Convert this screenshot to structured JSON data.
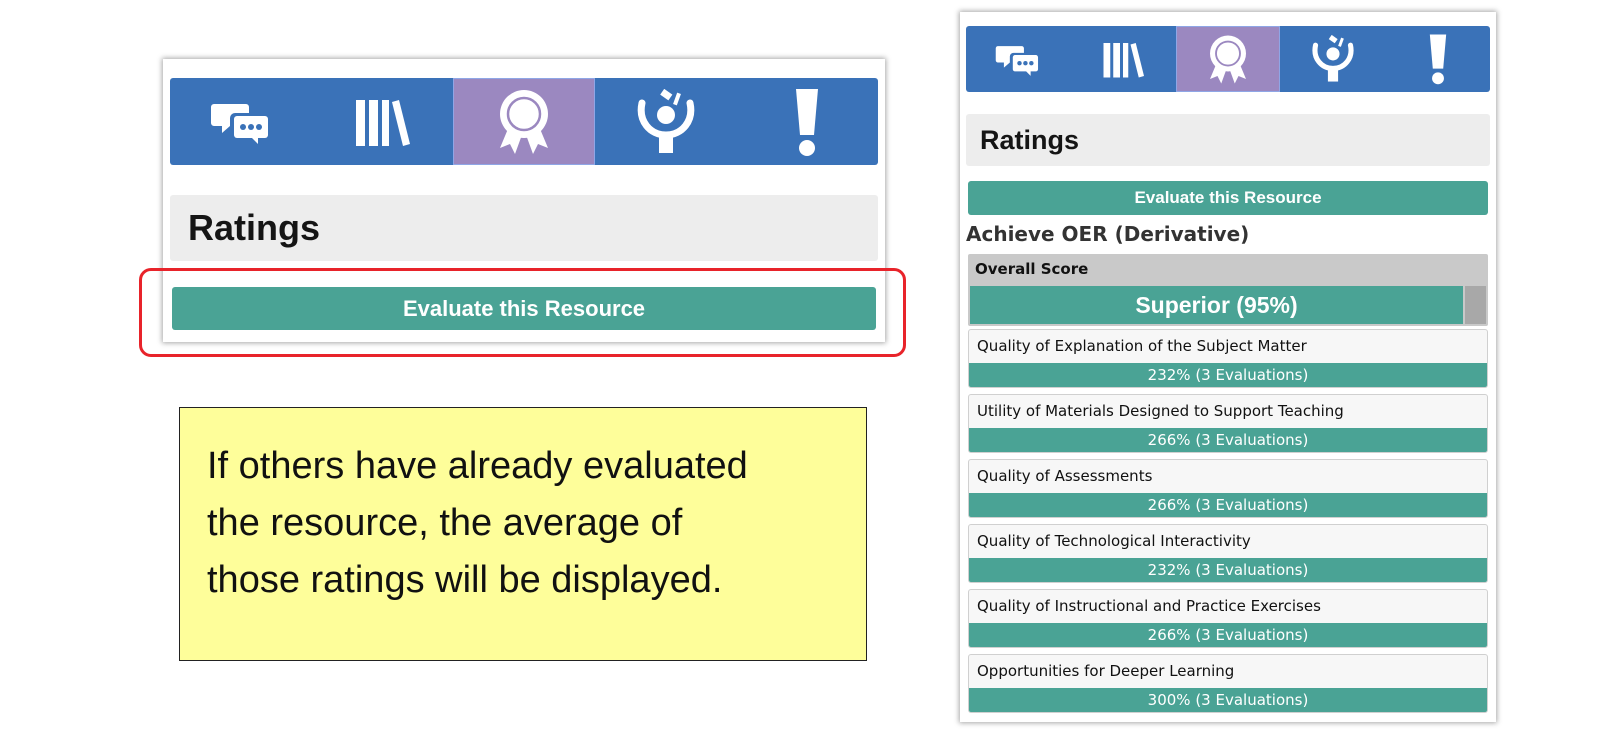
{
  "left_panel": {
    "tabs": [
      {
        "icon": "discussion-icon",
        "active": false
      },
      {
        "icon": "library-icon",
        "active": false
      },
      {
        "icon": "award-ribbon-icon",
        "active": true
      },
      {
        "icon": "person-standards-icon",
        "active": false
      },
      {
        "icon": "alert-icon",
        "active": false
      }
    ],
    "heading": "Ratings",
    "evaluate_label": "Evaluate this Resource"
  },
  "note": {
    "lines": [
      "If others have already evaluated",
      "the resource, the average of",
      "those ratings will be displayed."
    ]
  },
  "right_panel": {
    "heading": "Ratings",
    "evaluate_label": "Evaluate this Resource",
    "subtitle": "Achieve OER (Derivative)",
    "overall": {
      "label": "Overall Score",
      "value": "Superior (95%)"
    },
    "ratings": [
      {
        "label": "Quality of Explanation of the Subject Matter",
        "value": "232% (3 Evaluations)"
      },
      {
        "label": "Utility of Materials Designed to Support Teaching",
        "value": "266% (3 Evaluations)"
      },
      {
        "label": "Quality of Assessments",
        "value": "266% (3 Evaluations)"
      },
      {
        "label": "Quality of Technological Interactivity",
        "value": "232% (3 Evaluations)"
      },
      {
        "label": "Quality of Instructional and Practice Exercises",
        "value": "266% (3 Evaluations)"
      },
      {
        "label": "Opportunities for Deeper Learning",
        "value": "300% (3 Evaluations)"
      }
    ]
  },
  "colors": {
    "tab_bar": "#3a72b8",
    "tab_active": "#9b88c0",
    "button": "#4aa395",
    "highlight_outline": "#e8232a",
    "note_background": "#fefe9a"
  }
}
